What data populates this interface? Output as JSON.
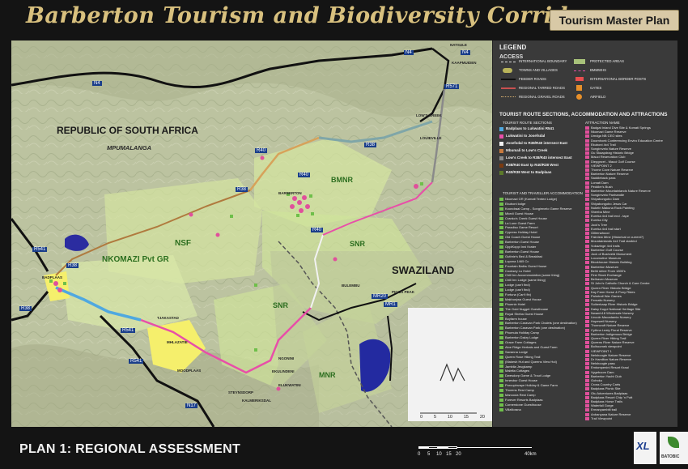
{
  "header": {
    "title": "Barberton Tourism and Biodiversity Corridor",
    "badge": "Tourism Master Plan"
  },
  "footer": {
    "plan_label": "PLAN 1: REGIONAL ASSESSMENT",
    "scale_ticks": [
      "0",
      "5",
      "10",
      "15",
      "20"
    ],
    "scale_unit": "40km",
    "logos": [
      "XL",
      "BATOBIC"
    ]
  },
  "map": {
    "region_labels": [
      "REPUBLIC OF SOUTH AFRICA",
      "MPUMALANGA",
      "SWAZILAND"
    ],
    "area_labels": [
      "BMNR",
      "NSF",
      "SNR",
      "NKOMAZI Pvt GR",
      "SNR",
      "MNR"
    ],
    "road_labels": [
      "N4",
      "N4",
      "R40",
      "R38",
      "R38",
      "R40",
      "R541",
      "R38",
      "R38",
      "R541",
      "R541",
      "N17",
      "MR20",
      "MR1",
      "R40",
      "R571",
      "N4"
    ],
    "town_labels": [
      "NATSULE",
      "KAAPMUIDEN",
      "LOW'S CREEK",
      "LOUIEVILLE",
      "BARBERTON",
      "BADPLAAS",
      "TJAKASTAD",
      "MHLAZATIE",
      "MOODPLAAS",
      "NGONINI",
      "EKULINDENI",
      "ELUKWATINI",
      "STEYNSDORP",
      "KALMERIKSDAL",
      "BULEMBU",
      "PIGGS PEAK"
    ],
    "inset_scale": [
      "0",
      "5",
      "10",
      "15",
      "20"
    ]
  },
  "legend": {
    "title": "LEGEND",
    "access_title": "ACCESS",
    "access_items_left": [
      "INTERNATIONAL BOUNDARY",
      "TOWNS AND VILLAGES",
      "FEEDER ROADS",
      "REGIONAL TARRED ROADS",
      "REGIONAL GRAVEL ROADS"
    ],
    "access_items_right": [
      "PROTECTED AREAS",
      "BMMWHS",
      "INTERNATIONAL BORDER POSTS",
      "GATES",
      "AIRFIELD"
    ],
    "sections_title": "TOURIST ROUTE SECTIONS, ACCOMMODATION AND ATTRACTIONS",
    "routes_title": "TOURIST ROUTE SECTIONS",
    "routes": [
      {
        "label": "Badplaas to Lukwatini R541",
        "color": "#4fa8e0"
      },
      {
        "label": "Lukwatini to Josefsdal",
        "color": "#e84fa8"
      },
      {
        "label": "Josefsdal to R38/R40 intersect East",
        "color": "#f2f2f2"
      },
      {
        "label": "Mbumali to Low's Creek",
        "color": "#c87a3e"
      },
      {
        "label": "Low's Creek to R38/R40 intersect East",
        "color": "#8a8a8a"
      },
      {
        "label": "R38/R40 East tp R40/R38 West",
        "color": "#7a3a10"
      },
      {
        "label": "R40/R38 West to Badplaas",
        "color": "#5c7a2a"
      }
    ],
    "accommodation_title": "TOURIST AND TRAVELLER ACCOMMODATION",
    "accommodation": [
      "Nkomazi GR (Komati Tented Lodge)",
      "Ekuboni lodge",
      "Koondraai Camp - Songimvelo Game Reserve",
      "Mkedi Guest House",
      "Cranko's Creek Guest House",
      "La Lune Guest Farm",
      "Paradiso Game Resort",
      "Cypress Holiday Hotel",
      "Old Coach Guest House",
      "Barberton Guest House",
      "OppiKoppi Inni Krater",
      "Barberton Guest House",
      "Guthrie's Bed & Breakfast",
      "Lupona 1465 Cc",
      "Fountain Baths Guest House",
      "Cooksey Lu Hotel",
      "Chill Inn Accommodation (same thing)",
      "Chill Inn Lodge (same thing)",
      "Lodge (can't find)",
      "Lodge (can't find)",
      "Fortuna (Can't fin)",
      "Makhonjwa Guest House",
      "Phoenix Hotel",
      "The Gold Nugget Guesthouse",
      "Royal Sheba Guest House",
      "Boyfarm house",
      "Barberton Caravan Park Chalets (one destination)",
      "Barberton Caravan Park (one destination)",
      "Phumula Holiday Camp",
      "Barberton Dakry Lodge",
      "Grace Farm Cottages",
      "Aloe Ridge Herbals and Guest Farm",
      "Savanna Lodge",
      "Queen Rose Hiking Trail",
      "(Makesh Hut and Queens View Hut)",
      "Jambila Jeugkamp",
      "Malelta Cottages",
      "Dwesdorp Game & Trout Lodge",
      "Innesbur Guest House",
      "Porcupinvaye Holiday & Game Farm",
      "Thorens Rest Camp",
      "Marcoula Rest Camp",
      "Forever Resorts Badplaas",
      "Cornerstone Guesthouse",
      "Villaflorana"
    ],
    "attractions_title": "ATTRACTION NAME",
    "attractions": [
      "Badgat Inland Dive Site & Komati Springs",
      "Nkomazi Game Reserve",
      "Umdga NB CEO sites",
      "Doornhoek Conferencing Enviro Education Centre",
      "Ekuboni 4x4 Trail",
      "Songimvelo Nature Reserve",
      "Ou Skaapdrag Historic Bridge",
      "Mauci Reservation Club",
      "Diepgezet - Mauci Golf Course",
      "VIEWPOINT 2",
      "Thorne Cove Nature Reserve",
      "Barberton Nature Reserve",
      "Saddleback pass",
      "Lomati Dam",
      "Peddler's Bush",
      "Barberton Mountainlands Nature Reserve",
      "Songimvelo Panhandle",
      "Shiyabongobo Dam",
      "Shiyabongobo Jesus Car",
      "Nukein Makuna Rock Painting",
      "Sheeba Mine",
      "Eureka 4x4 trail end - tape",
      "Eureka City",
      "Jock's Tree",
      "Eureka 4x4 trail start",
      "Gillernahood",
      "Fairview Mine (Historical or current?)",
      "Mountainlands 4x4 Trail starbird",
      "Vukazinge 4x4 trails",
      "Barberton Golf Course",
      "Jock of Bushveld Monument",
      "Locomotive Museum",
      "Blockhouse Historic Building",
      "Barberton Museum",
      "Belhi shine From 1800's",
      "First Stock Exchange",
      "Belhaven Museum",
      "St John's Catholic Church & Care Centre",
      "Queen River Historic Bridge",
      "Kay Farm Horse & Pony Rides",
      "Palmtrail War Games",
      "Fernatic Nursery",
      "Suikerkaap River Historic Bridge",
      "Daisy Koppi National Heritage Site",
      "Nwamh18 Wholesale Nursery",
      "Lincoln Macadamia Nursery",
      "Hopewell Nursery",
      "Thorncroft Nature Reserve",
      "Cythna Leaty Floral Reserve",
      "Barberton Indigenous Bridge",
      "Queen River Hiking Trail",
      "Queens River Nature Reserve",
      "Bolhoomek viewpoint",
      "VIEWPOINT 1",
      "Nelshoogte Nature Reserve",
      "Dr Hamilton Nature Reserve",
      "Nelshoogte pass",
      "Emtompenini Resort Kraal",
      "Vygeboom Dam",
      "Barberton Yacht Club",
      "Gohoku",
      "Cross Country Carts",
      "Badplaas Picnic Site",
      "Gtu Adventures Badplaas",
      "Badplaas Resort Chip 'n Putt",
      "Badplaas Horse Trails",
      "Waterfall Gorge",
      "Ermanyambiti trail",
      "Anbanyana Nature Reserve",
      "Trail Viewpoint"
    ],
    "colors": {
      "accommodation_marker": "#6fbf4a",
      "attraction_marker": "#e0509b",
      "protected_area": "#a8c27a",
      "international_boundary": "#e8e8e8"
    }
  }
}
